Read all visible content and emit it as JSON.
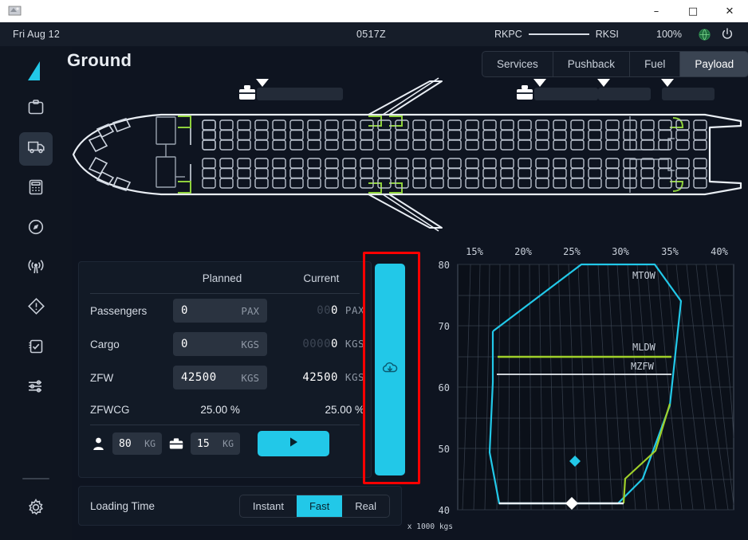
{
  "window": {
    "app_icon": "airplane-icon",
    "minimize": "–",
    "maximize": "□",
    "close": "✕"
  },
  "statusbar": {
    "date": "Fri Aug 12",
    "time": "0517Z",
    "origin": "RKPC",
    "destination": "RKSI",
    "battery": "100%",
    "globe_icon": "globe-icon",
    "power_icon": "power-icon"
  },
  "sidebar": {
    "logo": "tail-fin-logo",
    "items": [
      {
        "name": "dispatch",
        "icon": "clipboard-icon",
        "active": false
      },
      {
        "name": "ground",
        "icon": "truck-icon",
        "active": true
      },
      {
        "name": "performance",
        "icon": "calculator-icon",
        "active": false
      },
      {
        "name": "navigation",
        "icon": "compass-icon",
        "active": false
      },
      {
        "name": "atc",
        "icon": "radio-antenna-icon",
        "active": false
      },
      {
        "name": "failures",
        "icon": "warning-diamond-icon",
        "active": false
      },
      {
        "name": "checklists",
        "icon": "checklist-icon",
        "active": false
      },
      {
        "name": "controls",
        "icon": "sliders-icon",
        "active": false
      }
    ],
    "settings": {
      "name": "settings",
      "icon": "gear-icon"
    }
  },
  "header": {
    "title": "Ground",
    "tabs": [
      {
        "label": "Services",
        "active": false
      },
      {
        "label": "Pushback",
        "active": false
      },
      {
        "label": "Fuel",
        "active": false
      },
      {
        "label": "Payload",
        "active": true
      }
    ]
  },
  "aircraft": {
    "cargo_bays": [
      {
        "icon": "briefcase-icon",
        "marker": "triangle-down-icon"
      },
      {
        "icon": "briefcase-icon",
        "marker": "triangle-down-icon"
      },
      {
        "icon": "",
        "marker": "triangle-down-icon"
      },
      {
        "icon": "",
        "marker": "triangle-down-icon"
      }
    ]
  },
  "payload": {
    "columns": {
      "planned": "Planned",
      "current": "Current"
    },
    "rows": [
      {
        "label": "Passengers",
        "planned_value": "0",
        "planned_unit": "PAX",
        "current_leading": "00",
        "current_value": "0",
        "current_unit": "PAX"
      },
      {
        "label": "Cargo",
        "planned_value": "0",
        "planned_unit": "KGS",
        "current_leading": "0000",
        "current_value": "0",
        "current_unit": "KGS"
      },
      {
        "label": "ZFW",
        "planned_value": "42500",
        "planned_unit": "KGS",
        "current_leading": "",
        "current_value": "42500",
        "current_unit": "KGS"
      }
    ],
    "cg_row": {
      "label": "ZFWCG",
      "planned": "25.00 %",
      "current": "25.00 %"
    },
    "unit_weights": [
      {
        "icon": "person-icon",
        "value": "80",
        "unit": "KG"
      },
      {
        "icon": "briefcase-icon",
        "value": "15",
        "unit": "KG"
      }
    ],
    "action_button": {
      "name": "start-loading-button",
      "icon": "play-icon"
    }
  },
  "loading_time": {
    "label": "Loading Time",
    "options": [
      {
        "label": "Instant",
        "active": false
      },
      {
        "label": "Fast",
        "active": true
      },
      {
        "label": "Real",
        "active": false
      }
    ]
  },
  "cargo_bar": {
    "icon": "cloud-download-icon",
    "fill_percent": 100,
    "color": "#22c8e8"
  },
  "highlight": {
    "color": "#ff0000"
  },
  "chart_data": {
    "type": "line",
    "title": "",
    "xlabel": "",
    "ylabel": "x 1000 kgs",
    "x_ticks": [
      "15%",
      "20%",
      "25%",
      "30%",
      "35%",
      "40%"
    ],
    "x_tick_values": [
      15,
      20,
      25,
      30,
      35,
      40
    ],
    "y_ticks": [
      "80",
      "70",
      "60",
      "50",
      "40"
    ],
    "y_tick_values": [
      80,
      70,
      60,
      50,
      40
    ],
    "xlim": [
      13.0,
      42.0
    ],
    "ylim": [
      37.5,
      81.5
    ],
    "grid": true,
    "legend": "inline-annotations",
    "series": [
      {
        "name": "MTOW envelope",
        "color": "#22c8e8",
        "label": "MTOW",
        "label_x": 32.0,
        "label_y": 78.0,
        "points": [
          [
            18.6,
            71.6
          ],
          [
            27.7,
            79.3
          ],
          [
            35.2,
            79.3
          ],
          [
            37.9,
            74.6
          ],
          [
            36.8,
            57.5
          ],
          [
            34.0,
            45.6
          ],
          [
            31.5,
            42.6
          ],
          [
            19.3,
            42.6
          ],
          [
            18.3,
            52.8
          ],
          [
            18.6,
            64.2
          ],
          [
            18.6,
            71.6
          ]
        ]
      },
      {
        "name": "MLDW limit",
        "color": "#9fcf2a",
        "label": "MLDW",
        "label_x": 32.0,
        "label_y": 69.2,
        "points": [
          [
            19.1,
            67.3
          ],
          [
            36.9,
            67.3
          ]
        ]
      },
      {
        "name": "MLDW lower boundary",
        "color": "#9fcf2a",
        "points": [
          [
            36.7,
            57.6
          ],
          [
            35.2,
            49.9
          ],
          [
            32.1,
            45.6
          ],
          [
            31.9,
            42.6
          ]
        ]
      },
      {
        "name": "MZFW limit",
        "color": "#e8edf2",
        "label": "MZFW",
        "label_x": 31.8,
        "label_y": 65.8,
        "points": [
          [
            19.0,
            64.3
          ],
          [
            36.8,
            64.3
          ]
        ]
      },
      {
        "name": "MZFW lower boundary",
        "color": "#e8edf2",
        "points": [
          [
            19.3,
            42.6
          ],
          [
            31.9,
            42.6
          ]
        ]
      }
    ],
    "markers": [
      {
        "name": "takeoff-cg-marker",
        "x": 25.0,
        "y": 46.6,
        "color": "#22c8e8",
        "shape": "diamond"
      },
      {
        "name": "zfw-cg-marker",
        "x": 24.8,
        "y": 42.6,
        "color": "#ffffff",
        "shape": "diamond"
      }
    ]
  }
}
